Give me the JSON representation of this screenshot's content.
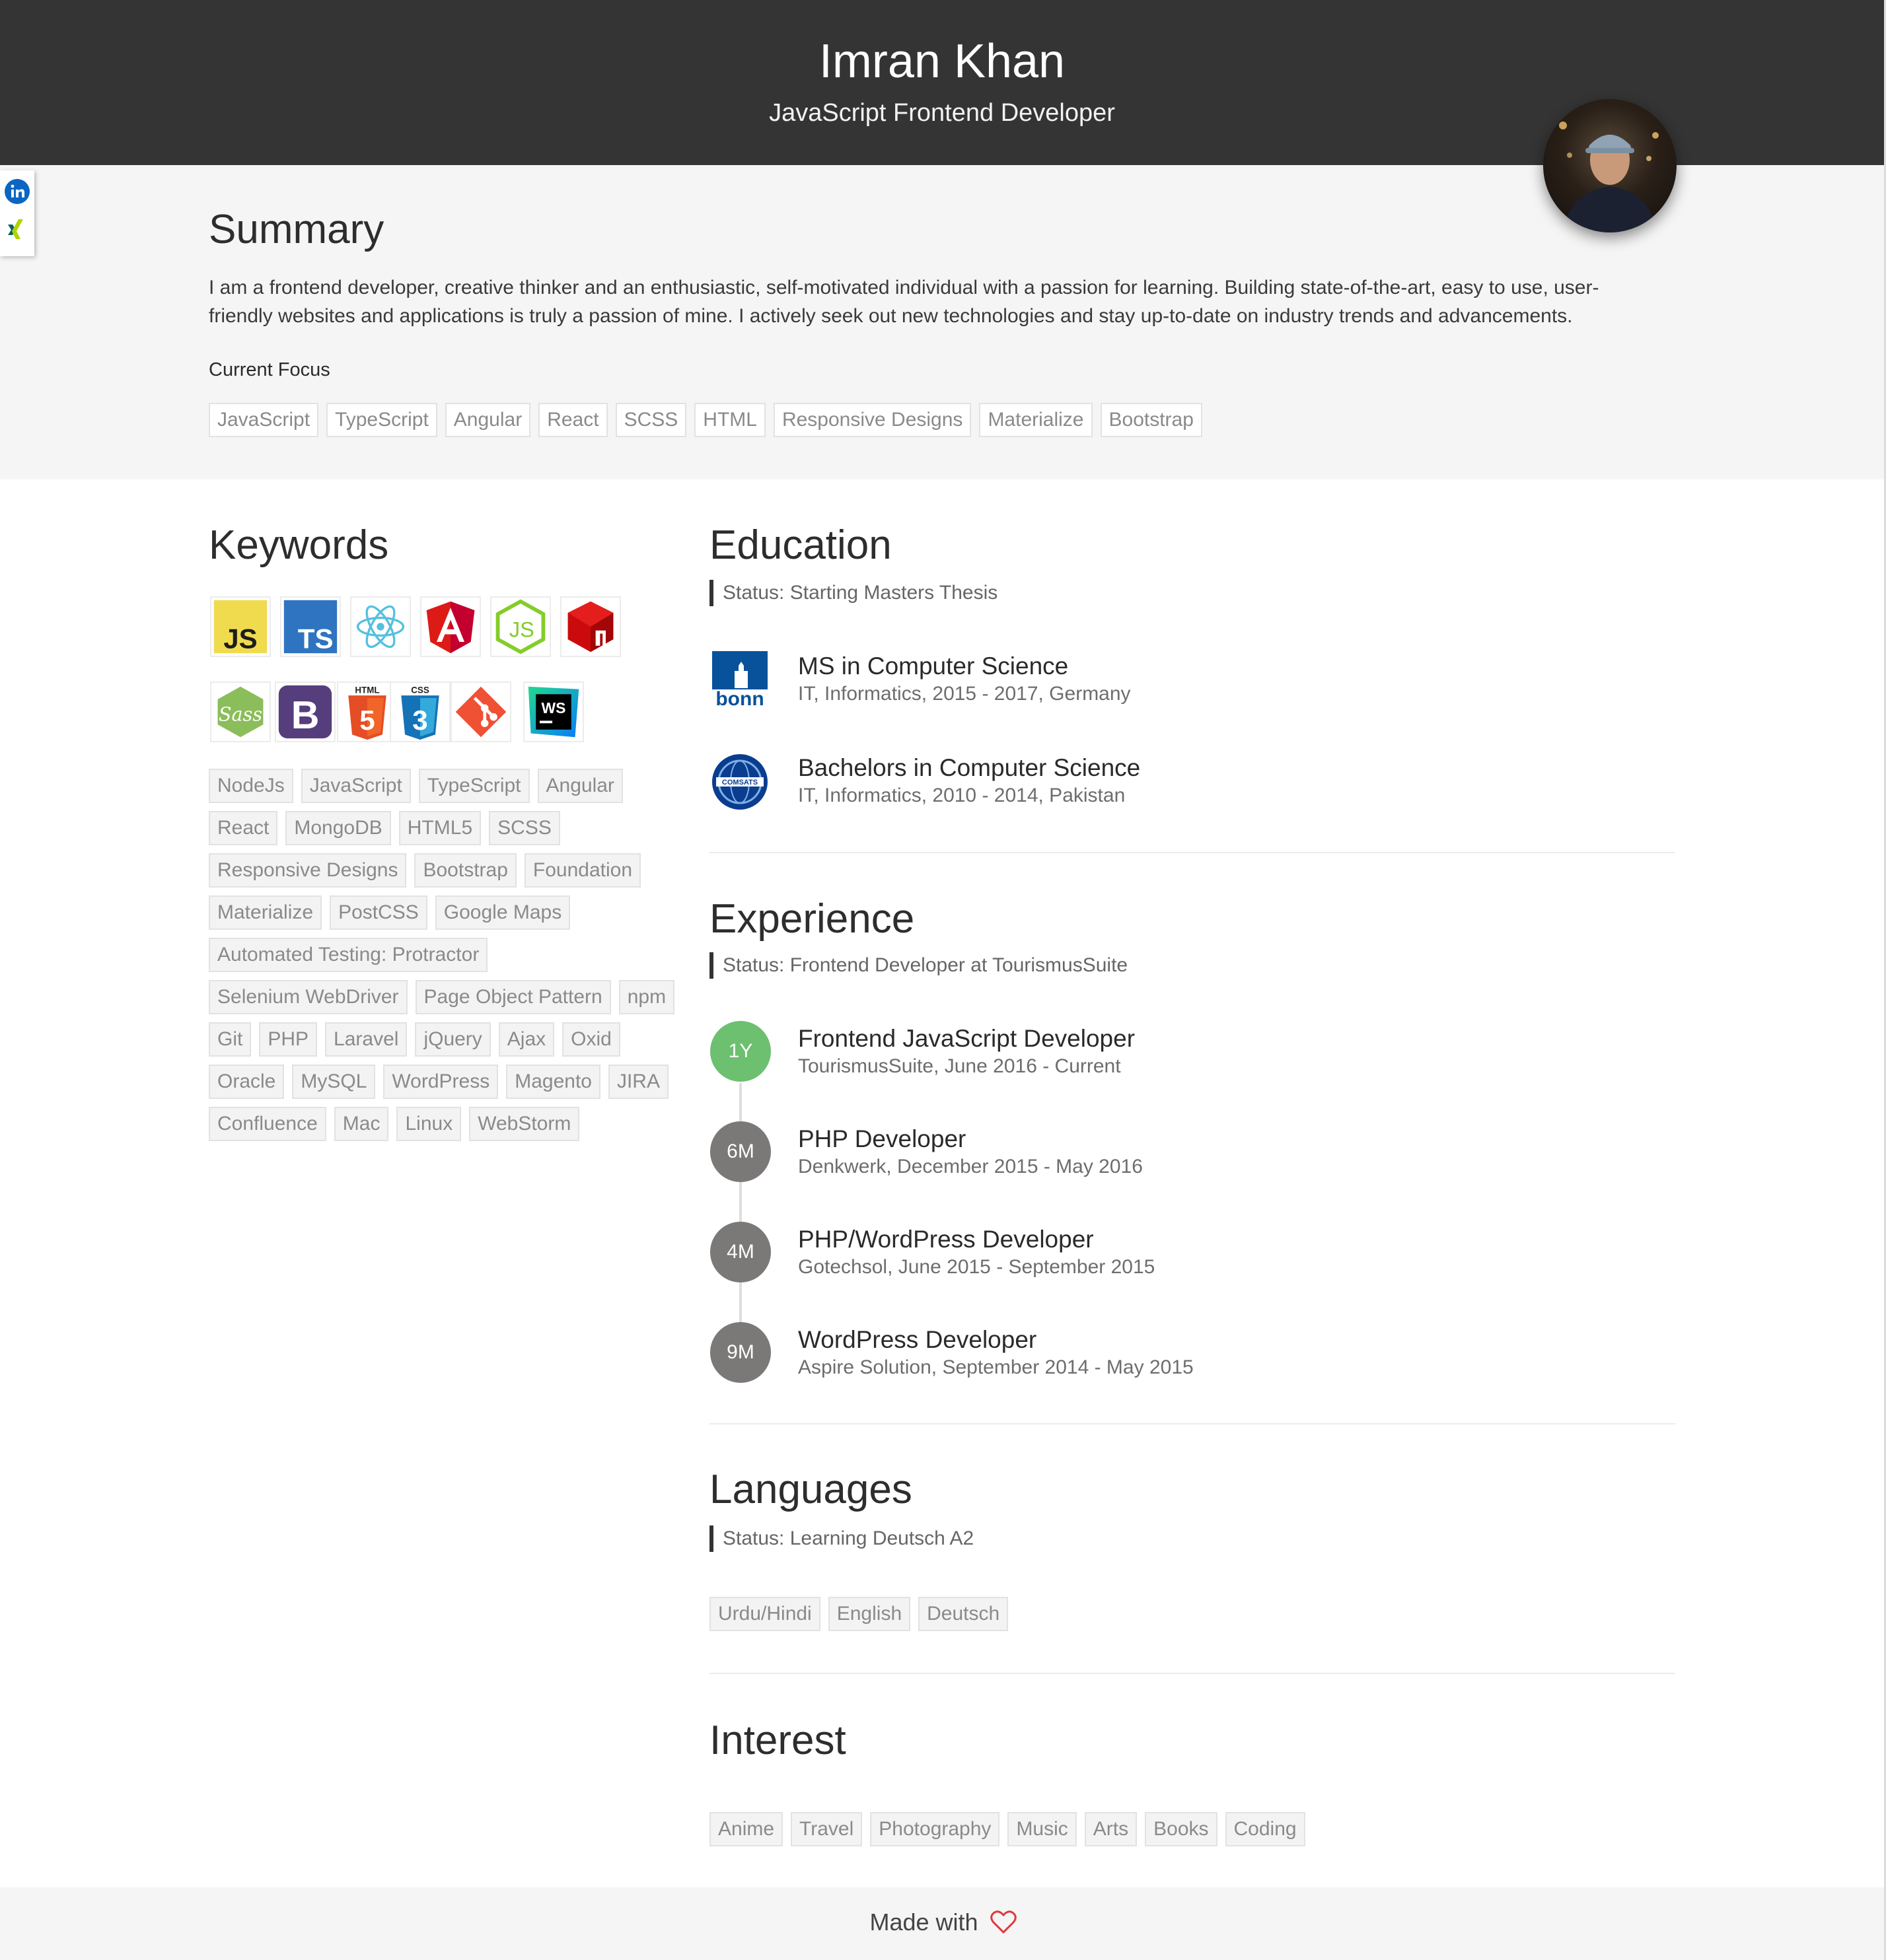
{
  "header": {
    "name": "Imran Khan",
    "role": "JavaScript Frontend Developer"
  },
  "social": {
    "items": [
      {
        "icon": "linkedin-icon",
        "color": "#0a66c2"
      },
      {
        "icon": "xing-icon",
        "color": "#026466"
      }
    ]
  },
  "summary": {
    "title": "Summary",
    "text": "I am a frontend developer, creative thinker and an enthusiastic, self-motivated individual with a passion for learning. Building state-of-the-art, easy to use, user-friendly websites and applications is truly a passion of mine. I actively seek out new technologies and stay up-to-date on industry trends and advancements.",
    "focus_label": "Current Focus",
    "focus_tags": [
      "JavaScript",
      "TypeScript",
      "Angular",
      "React",
      "SCSS",
      "HTML",
      "Responsive Designs",
      "Materialize",
      "Bootstrap"
    ]
  },
  "keywords": {
    "title": "Keywords",
    "icons": [
      "javascript-icon",
      "typescript-icon",
      "react-icon",
      "angular-icon",
      "nodejs-icon",
      "npm-icon",
      "sass-icon",
      "bootstrap-icon",
      "html5-icon",
      "css3-icon",
      "git-icon",
      "webstorm-icon"
    ],
    "tags": [
      "NodeJs",
      "JavaScript",
      "TypeScript",
      "Angular",
      "React",
      "MongoDB",
      "HTML5",
      "SCSS",
      "Responsive Designs",
      "Bootstrap",
      "Foundation",
      "Materialize",
      "PostCSS",
      "Google Maps",
      "Automated Testing: Protractor",
      "Selenium WebDriver",
      "Page Object Pattern",
      "npm",
      "Git",
      "PHP",
      "Laravel",
      "jQuery",
      "Ajax",
      "Oxid",
      "Oracle",
      "MySQL",
      "WordPress",
      "Magento",
      "JIRA",
      "Confluence",
      "Mac",
      "Linux",
      "WebStorm"
    ]
  },
  "education": {
    "title": "Education",
    "status": "Status: Starting Masters Thesis",
    "items": [
      {
        "title": "MS in Computer Science",
        "sub": "IT, Informatics, 2015 - 2017, Germany",
        "logo_text": "bonn"
      },
      {
        "title": "Bachelors in Computer Science",
        "sub": "IT, Informatics, 2010 - 2014, Pakistan",
        "logo_text": "COMSATS"
      }
    ]
  },
  "experience": {
    "title": "Experience",
    "status": "Status: Frontend Developer at TourismusSuite",
    "items": [
      {
        "badge": "1Y",
        "title": "Frontend JavaScript Developer",
        "sub": "TourismusSuite, June 2016 - Current",
        "color": "#6cc06f"
      },
      {
        "badge": "6M",
        "title": "PHP Developer",
        "sub": "Denkwerk, December 2015 - May 2016",
        "color": "#7b7878"
      },
      {
        "badge": "4M",
        "title": "PHP/WordPress Developer",
        "sub": "Gotechsol, June 2015 - September 2015",
        "color": "#7b7878"
      },
      {
        "badge": "9M",
        "title": "WordPress Developer",
        "sub": "Aspire Solution, September 2014 - May 2015",
        "color": "#7b7878"
      }
    ]
  },
  "languages": {
    "title": "Languages",
    "status": "Status: Learning Deutsch A2",
    "tags": [
      "Urdu/Hindi",
      "English",
      "Deutsch"
    ]
  },
  "interest": {
    "title": "Interest",
    "tags": [
      "Anime",
      "Travel",
      "Photography",
      "Music",
      "Arts",
      "Books",
      "Coding"
    ]
  },
  "footer": {
    "text": "Made with",
    "icon": "heart-icon",
    "heart_color": "#e0383e"
  }
}
